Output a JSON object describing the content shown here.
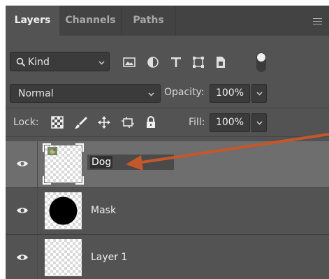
{
  "tabs": [
    {
      "label": "Layers",
      "active": true
    },
    {
      "label": "Channels",
      "active": false
    },
    {
      "label": "Paths",
      "active": false
    }
  ],
  "filter": {
    "kind_label": "Kind",
    "icons": [
      "image-filter-icon",
      "adjustment-filter-icon",
      "type-filter-icon",
      "shape-filter-icon",
      "smart-object-filter-icon",
      "filter-toggle-icon"
    ]
  },
  "blend": {
    "mode": "Normal"
  },
  "opacity": {
    "label": "Opacity:",
    "value": "100%"
  },
  "lock": {
    "label": "Lock:",
    "icons": [
      "lock-transparent-pixels-icon",
      "lock-image-pixels-icon",
      "lock-position-icon",
      "lock-artboard-icon",
      "lock-all-icon"
    ]
  },
  "fill": {
    "label": "Fill:",
    "value": "100%"
  },
  "layers": [
    {
      "name": "Dog",
      "selected": true,
      "editing": true,
      "thumb": "transparent"
    },
    {
      "name": "Mask",
      "selected": false,
      "editing": false,
      "thumb": "black-circle"
    },
    {
      "name": "Layer 1",
      "selected": false,
      "editing": false,
      "thumb": "transparent"
    }
  ],
  "colors": {
    "panel": "#535353",
    "selected_row": "#6e6e6e",
    "annotation_arrow": "#c5582a"
  }
}
